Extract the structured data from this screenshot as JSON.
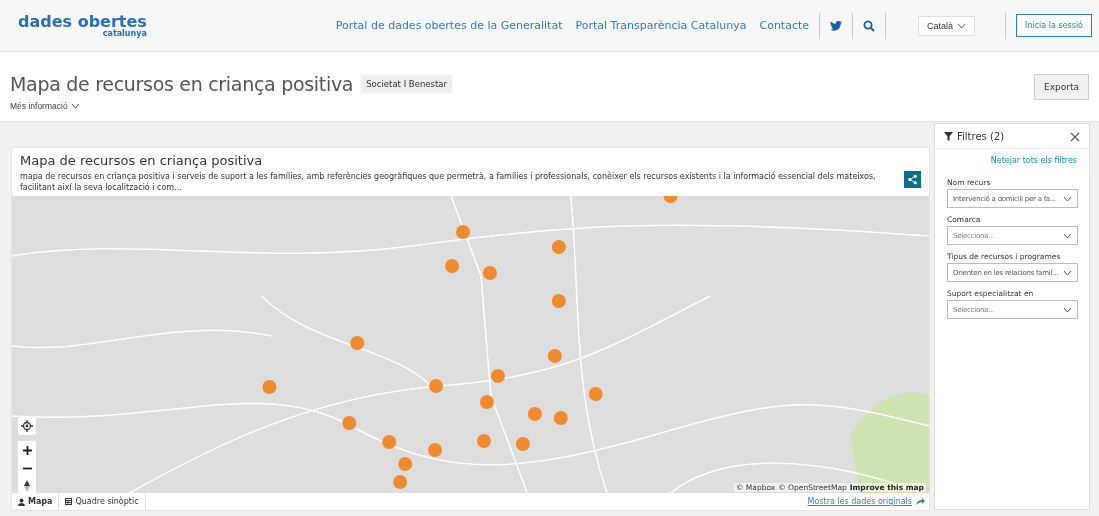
{
  "header": {
    "logo": {
      "title": "dades obertes",
      "subtitle": "catalunya"
    },
    "nav": [
      "Portal de dades obertes de la Generalitat",
      "Portal Transparència Catalunya",
      "Contacte"
    ],
    "language": "Català",
    "login": "Inicia la sessió"
  },
  "page": {
    "title": "Mapa de recursos en criança positiva",
    "category": "Societat I Benestar",
    "more_info": "Més informació",
    "export": "Exporta"
  },
  "card": {
    "title": "Mapa de recursos en criança positiva",
    "description": "mapa de recursos en criança positiva i serveis de suport a les famílies, amb referències geogràfiques que permetrà, a famílies i professionals, conèixer els recursos existents i la informació essencial dels mateixos, facilitant així la seva localització i com...",
    "attribution": [
      "© Mapbox",
      "© OpenStreetMap"
    ],
    "improve": "Improve this map",
    "tabs": [
      {
        "label": "Mapa",
        "selected": true
      },
      {
        "label": "Quadre sinòptic",
        "selected": false
      }
    ],
    "original_data_link": "Mostra les dades originals"
  },
  "filters": {
    "title": "Filtres (2)",
    "clear": "Netejar tots els filtres",
    "fields": [
      {
        "label": "Nom recurs",
        "value": "Intervenció a domicili per a fa..."
      },
      {
        "label": "Comarca",
        "placeholder": "Selecciona..."
      },
      {
        "label": "Tipus de recursos i programes",
        "value": "Orienten en les relacions famil..."
      },
      {
        "label": "Suport especialitzat en",
        "placeholder": "Selecciona..."
      }
    ]
  }
}
